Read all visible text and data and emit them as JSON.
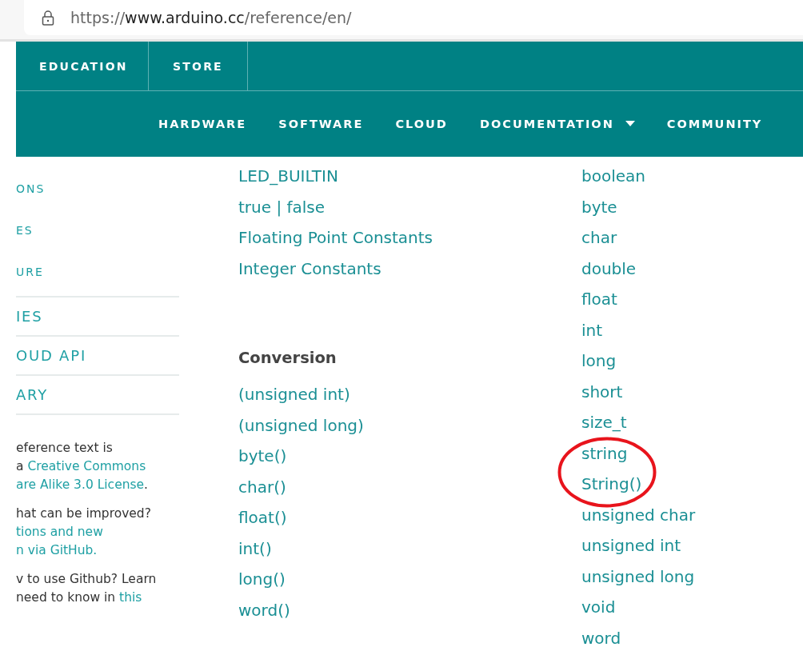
{
  "address_bar": {
    "url_prefix": "https://",
    "url_host": "www.arduino.cc",
    "url_path": "/reference/en/"
  },
  "top_nav": [
    "EDUCATION",
    "STORE"
  ],
  "main_nav": [
    {
      "label": "HARDWARE",
      "dropdown": false
    },
    {
      "label": "SOFTWARE",
      "dropdown": false
    },
    {
      "label": "CLOUD",
      "dropdown": false
    },
    {
      "label": "DOCUMENTATION",
      "dropdown": true
    },
    {
      "label": "COMMUNITY",
      "dropdown": false
    }
  ],
  "sidebar": {
    "items": [
      {
        "label": "ONS",
        "kind": "small"
      },
      {
        "label": "ES",
        "kind": "small"
      },
      {
        "label": "URE",
        "kind": "small"
      },
      {
        "label": "IES",
        "kind": "large"
      },
      {
        "label": "OUD API",
        "kind": "large"
      },
      {
        "label": "ARY",
        "kind": "large"
      }
    ],
    "paragraphs": [
      [
        [
          {
            "text": "eference text is",
            "link": false
          }
        ],
        [
          {
            "text": "a ",
            "link": false
          },
          {
            "text": "Creative Commons",
            "link": true
          }
        ],
        [
          {
            "text": "are Alike 3.0 License",
            "link": true
          },
          {
            "text": ".",
            "link": false
          }
        ]
      ],
      [
        [
          {
            "text": "hat can be improved?",
            "link": false
          }
        ],
        [
          {
            "text": "tions and new",
            "link": true
          }
        ],
        [
          {
            "text": "n via GitHub.",
            "link": true
          }
        ]
      ],
      [
        [
          {
            "text": "v to use Github? Learn",
            "link": false
          }
        ],
        [
          {
            "text": "need to know in ",
            "link": false
          },
          {
            "text": "this",
            "link": true
          }
        ]
      ]
    ]
  },
  "column_1": [
    {
      "items": [
        "LED_BUILTIN",
        "true | false",
        "Floating Point Constants",
        "Integer Constants"
      ]
    },
    {
      "heading": "Conversion",
      "items": [
        "(unsigned int)",
        "(unsigned long)",
        "byte()",
        "char()",
        "float()",
        "int()",
        "long()",
        "word()"
      ]
    }
  ],
  "column_2": [
    {
      "label": "boolean",
      "circled": false
    },
    {
      "label": "byte",
      "circled": false
    },
    {
      "label": "char",
      "circled": false
    },
    {
      "label": "double",
      "circled": false
    },
    {
      "label": "float",
      "circled": false
    },
    {
      "label": "int",
      "circled": false
    },
    {
      "label": "long",
      "circled": false
    },
    {
      "label": "short",
      "circled": false
    },
    {
      "label": "size_t",
      "circled": false
    },
    {
      "label": "string",
      "circled": true
    },
    {
      "label": "String()",
      "circled": true
    },
    {
      "label": "unsigned char",
      "circled": false
    },
    {
      "label": "unsigned int",
      "circled": false
    },
    {
      "label": "unsigned long",
      "circled": false
    },
    {
      "label": "void",
      "circled": false
    },
    {
      "label": "word",
      "circled": false
    }
  ],
  "annotation": {
    "color": "#e8141c"
  }
}
